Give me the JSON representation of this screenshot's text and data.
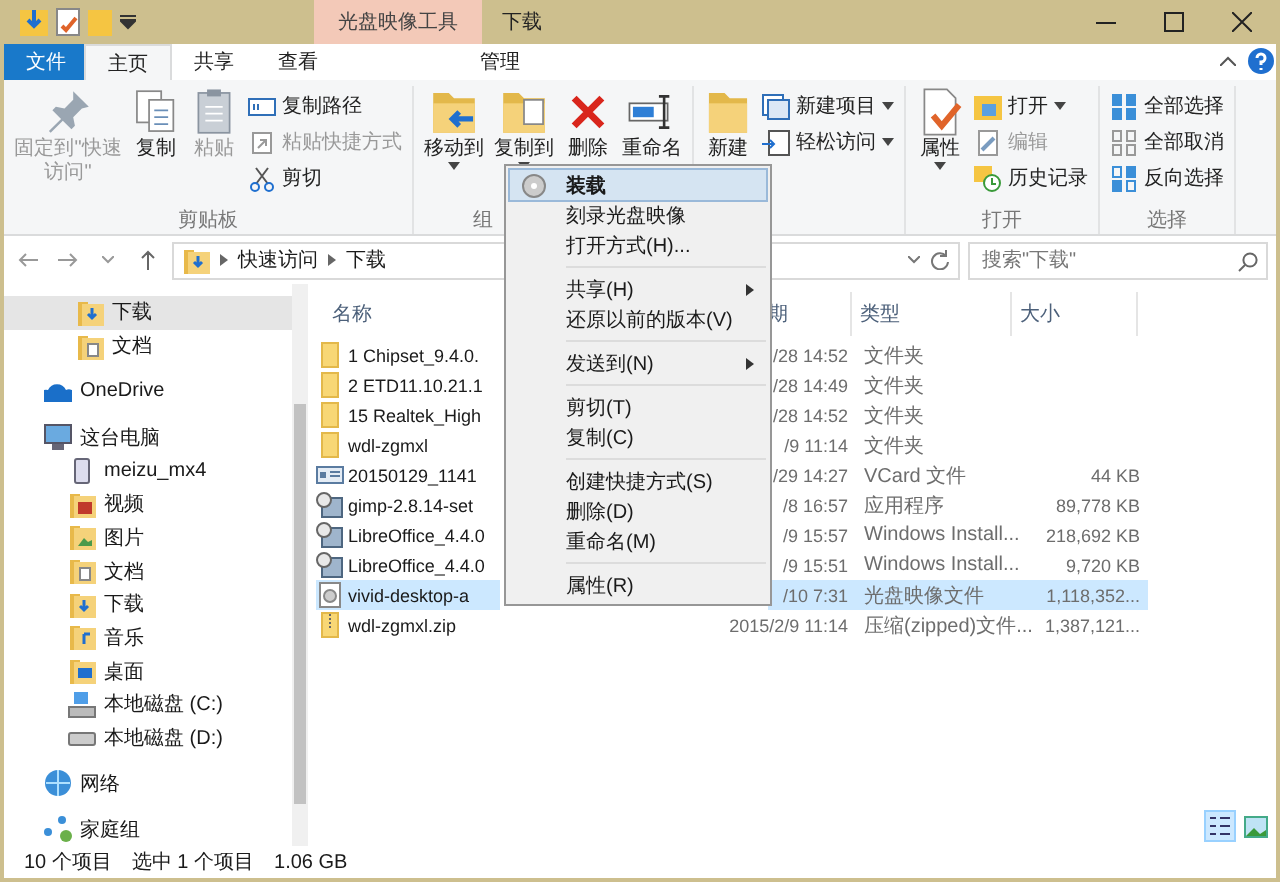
{
  "title_bar": {
    "contextual_tab": "光盘映像工具",
    "title": "下载"
  },
  "ribbon_tabs": [
    {
      "label": "文件",
      "kind": "file",
      "selected": false
    },
    {
      "label": "主页",
      "kind": "tab",
      "selected": true
    },
    {
      "label": "共享",
      "kind": "tab",
      "selected": false
    },
    {
      "label": "查看",
      "kind": "tab",
      "selected": false
    },
    {
      "label": "管理",
      "kind": "contextual",
      "selected": false
    }
  ],
  "ribbon_groups": [
    {
      "label": "剪贴板",
      "large": [
        {
          "label": "固定到\"快速访问\"",
          "kind": "pin",
          "disabled": true
        },
        {
          "label": "复制",
          "kind": "copy",
          "disabled": false
        },
        {
          "label": "粘贴",
          "kind": "paste",
          "disabled": true
        }
      ],
      "small": [
        {
          "label": "复制路径",
          "kind": "path",
          "disabled": false
        },
        {
          "label": "粘贴快捷方式",
          "kind": "shortcut",
          "disabled": true
        },
        {
          "label": "剪切",
          "kind": "cut",
          "disabled": false
        }
      ]
    },
    {
      "label": "组",
      "large": [
        {
          "label": "移动到",
          "kind": "move",
          "disabled": false
        },
        {
          "label": "复制到",
          "kind": "copyto",
          "disabled": false
        },
        {
          "label": "删除",
          "kind": "delete",
          "disabled": false
        },
        {
          "label": "重命名",
          "kind": "rename",
          "disabled": false
        }
      ]
    },
    {
      "large": [
        {
          "label": "新建",
          "kind": "newfolder",
          "disabled": false
        }
      ],
      "small": [
        {
          "label": "新建项目",
          "kind": "newitem",
          "disabled": false
        },
        {
          "label": "轻松访问",
          "kind": "easy",
          "disabled": false
        }
      ]
    },
    {
      "label": "打开",
      "large": [
        {
          "label": "属性",
          "kind": "props",
          "disabled": false
        }
      ],
      "small": [
        {
          "label": "打开",
          "kind": "open",
          "disabled": false
        },
        {
          "label": "编辑",
          "kind": "edit",
          "disabled": true
        },
        {
          "label": "历史记录",
          "kind": "history",
          "disabled": false
        }
      ]
    },
    {
      "label": "选择",
      "small": [
        {
          "label": "全部选择",
          "kind": "selall",
          "disabled": false
        },
        {
          "label": "全部取消",
          "kind": "selnone",
          "disabled": false
        },
        {
          "label": "反向选择",
          "kind": "selinv",
          "disabled": false
        }
      ]
    }
  ],
  "address": {
    "crumbs": [
      "快速访问",
      "下载"
    ],
    "search_placeholder": "搜索\"下载\""
  },
  "sidebar": [
    {
      "label": "下载",
      "kind": "download",
      "selected": true
    },
    {
      "label": "文档",
      "kind": "docs",
      "selected": false
    },
    {
      "label": "OneDrive",
      "kind": "cloud",
      "selected": false
    },
    {
      "label": "这台电脑",
      "kind": "pc",
      "selected": false,
      "children": [
        {
          "label": "meizu_mx4",
          "kind": "phone",
          "selected": false
        },
        {
          "label": "视频",
          "kind": "video",
          "selected": false
        },
        {
          "label": "图片",
          "kind": "pictures",
          "selected": false
        },
        {
          "label": "文档",
          "kind": "docs",
          "selected": false
        },
        {
          "label": "下载",
          "kind": "download",
          "selected": false
        },
        {
          "label": "音乐",
          "kind": "music",
          "selected": false
        },
        {
          "label": "桌面",
          "kind": "desktop",
          "selected": false
        },
        {
          "label": "本地磁盘 (C:)",
          "kind": "sysdrive",
          "selected": false
        },
        {
          "label": "本地磁盘 (D:)",
          "kind": "drive",
          "selected": false
        }
      ]
    },
    {
      "label": "网络",
      "kind": "network",
      "selected": false
    },
    {
      "label": "家庭组",
      "kind": "homegroup",
      "selected": false
    }
  ],
  "table": {
    "columns": [
      "名称",
      "期",
      "类型",
      "大小"
    ],
    "rows": [
      {
        "name": "1 Chipset_9.4.0.",
        "date": "/28 14:52",
        "type": "文件夹",
        "kind": "folder",
        "selected": false
      },
      {
        "name": "2 ETD11.10.21.1",
        "date": "/28 14:49",
        "type": "文件夹",
        "kind": "folder",
        "selected": false
      },
      {
        "name": "15 Realtek_High",
        "date": "/28 14:52",
        "type": "文件夹",
        "kind": "folder",
        "selected": false
      },
      {
        "name": "wdl-zgmxl",
        "date": "/9 11:14",
        "type": "文件夹",
        "kind": "folder",
        "selected": false
      },
      {
        "name": "20150129_1141",
        "date": "/29 14:27",
        "type": "VCard 文件",
        "size": "44 KB",
        "kind": "vcard",
        "selected": false
      },
      {
        "name": "gimp-2.8.14-set",
        "date": "/8 16:57",
        "type": "应用程序",
        "size": "89,778 KB",
        "kind": "installer",
        "selected": false
      },
      {
        "name": "LibreOffice_4.4.0",
        "date": "/9 15:57",
        "type": "Windows Install...",
        "size": "218,692 KB",
        "kind": "installer",
        "selected": false
      },
      {
        "name": "LibreOffice_4.4.0",
        "date": "/9 15:51",
        "type": "Windows Install...",
        "size": "9,720 KB",
        "kind": "installer",
        "selected": false
      },
      {
        "name": "vivid-desktop-a",
        "date": "/10 7:31",
        "type": "光盘映像文件",
        "size": "1,118,352...",
        "kind": "disc",
        "selected": true
      },
      {
        "name": "wdl-zgmxl.zip",
        "date": "2015/2/9 11:14",
        "type": "压缩(zipped)文件...",
        "size": "1,387,121...",
        "kind": "zip",
        "selected": false
      }
    ]
  },
  "context_menu": [
    [
      {
        "label": "装载",
        "submenu": false,
        "selected": true,
        "kind": "disc"
      },
      {
        "label": "刻录光盘映像",
        "submenu": false,
        "selected": false,
        "kind": "plain"
      },
      {
        "label": "打开方式(H)...",
        "submenu": false,
        "selected": false,
        "kind": "plain"
      }
    ],
    [
      {
        "label": "共享(H)",
        "submenu": true,
        "selected": false,
        "kind": "plain"
      },
      {
        "label": "还原以前的版本(V)",
        "submenu": false,
        "selected": false,
        "kind": "plain"
      }
    ],
    [
      {
        "label": "发送到(N)",
        "submenu": true,
        "selected": false,
        "kind": "plain"
      }
    ],
    [
      {
        "label": "剪切(T)",
        "submenu": false,
        "selected": false,
        "kind": "plain"
      },
      {
        "label": "复制(C)",
        "submenu": false,
        "selected": false,
        "kind": "plain"
      }
    ],
    [
      {
        "label": "创建快捷方式(S)",
        "submenu": false,
        "selected": false,
        "kind": "plain"
      },
      {
        "label": "删除(D)",
        "submenu": false,
        "selected": false,
        "kind": "plain"
      },
      {
        "label": "重命名(M)",
        "submenu": false,
        "selected": false,
        "kind": "plain"
      }
    ],
    [
      {
        "label": "属性(R)",
        "submenu": false,
        "selected": false,
        "kind": "plain"
      }
    ]
  ],
  "status_bar": {
    "count": "10 个项目",
    "selection": "选中 1 个项目",
    "size": "1.06 GB"
  }
}
